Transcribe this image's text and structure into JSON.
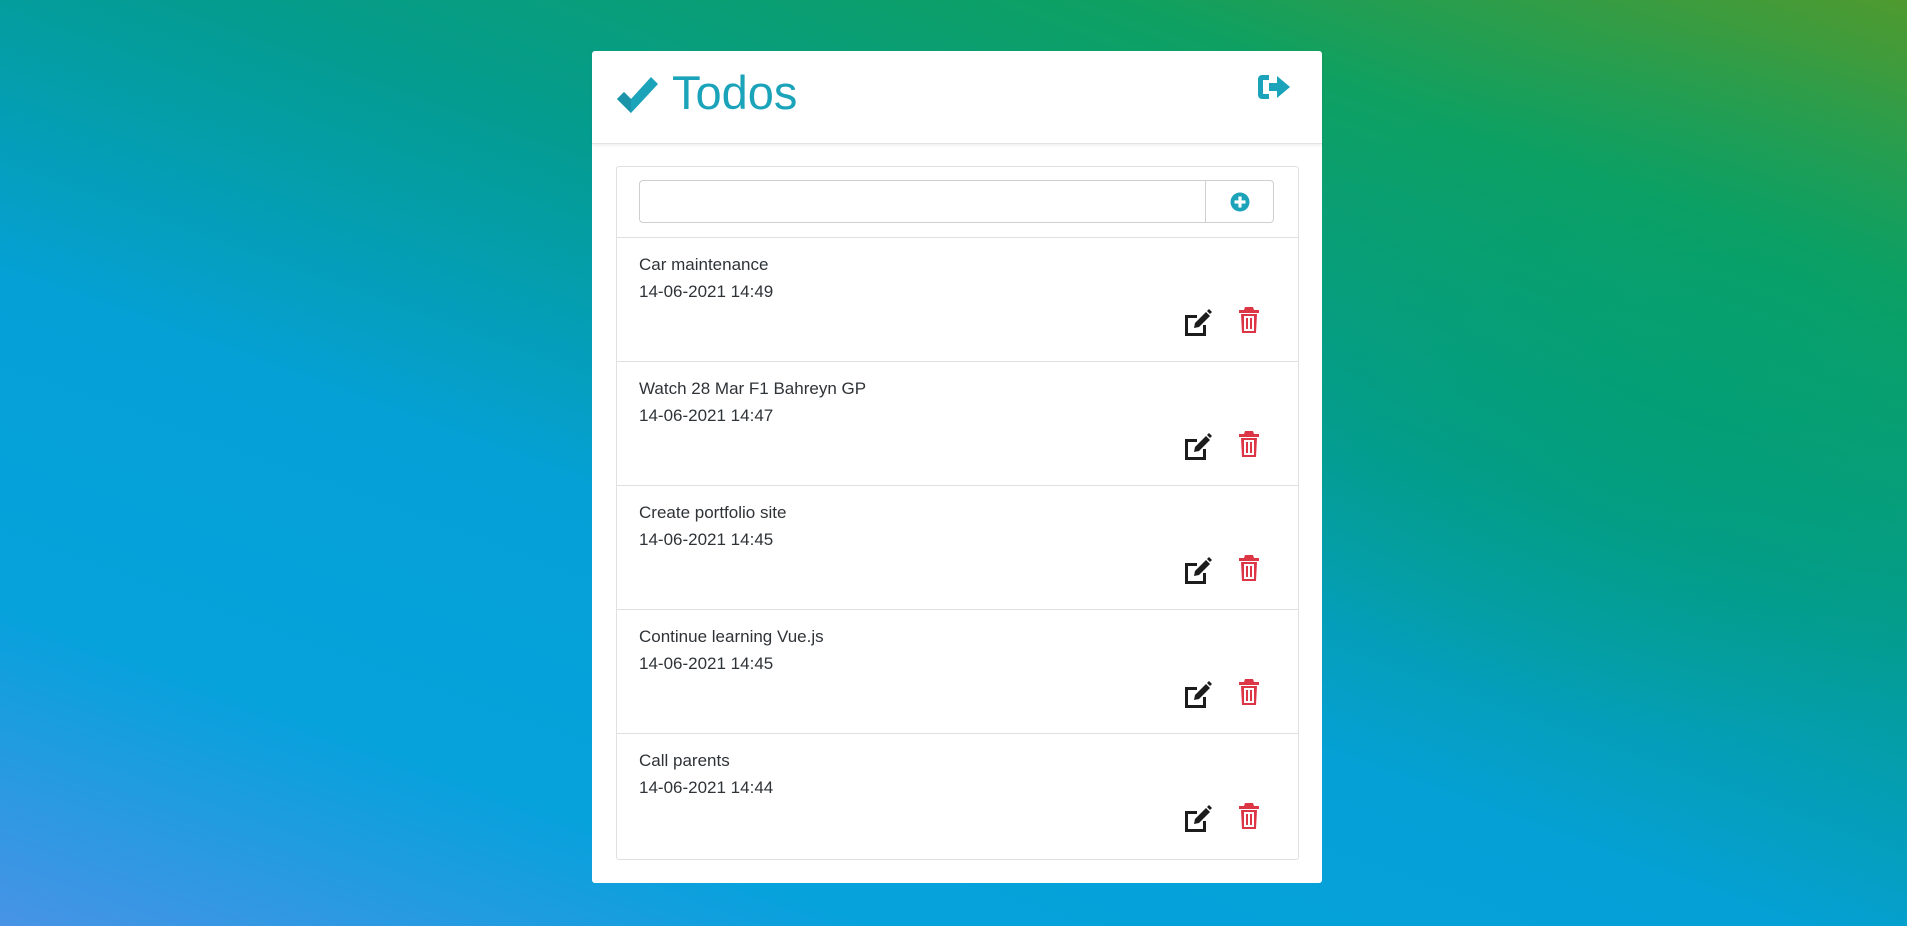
{
  "app": {
    "title": "Todos",
    "brand_icon": "double-check-icon",
    "accent_color": "#1ba3ba",
    "logout_icon": "sign-out-icon"
  },
  "new_todo": {
    "value": "",
    "placeholder": "",
    "add_icon": "plus-circle-icon"
  },
  "todos": [
    {
      "title": "Car maintenance",
      "date": "14-06-2021 14:49"
    },
    {
      "title": "Watch 28 Mar F1 Bahreyn GP",
      "date": "14-06-2021 14:47"
    },
    {
      "title": "Create portfolio site",
      "date": "14-06-2021 14:45"
    },
    {
      "title": "Continue learning Vue.js",
      "date": "14-06-2021 14:45"
    },
    {
      "title": "Call parents",
      "date": "14-06-2021 14:44"
    }
  ],
  "actions": {
    "edit_icon": "edit-icon",
    "delete_icon": "trash-icon",
    "edit_color": "#1c1c1c",
    "delete_color": "#dc3545"
  }
}
